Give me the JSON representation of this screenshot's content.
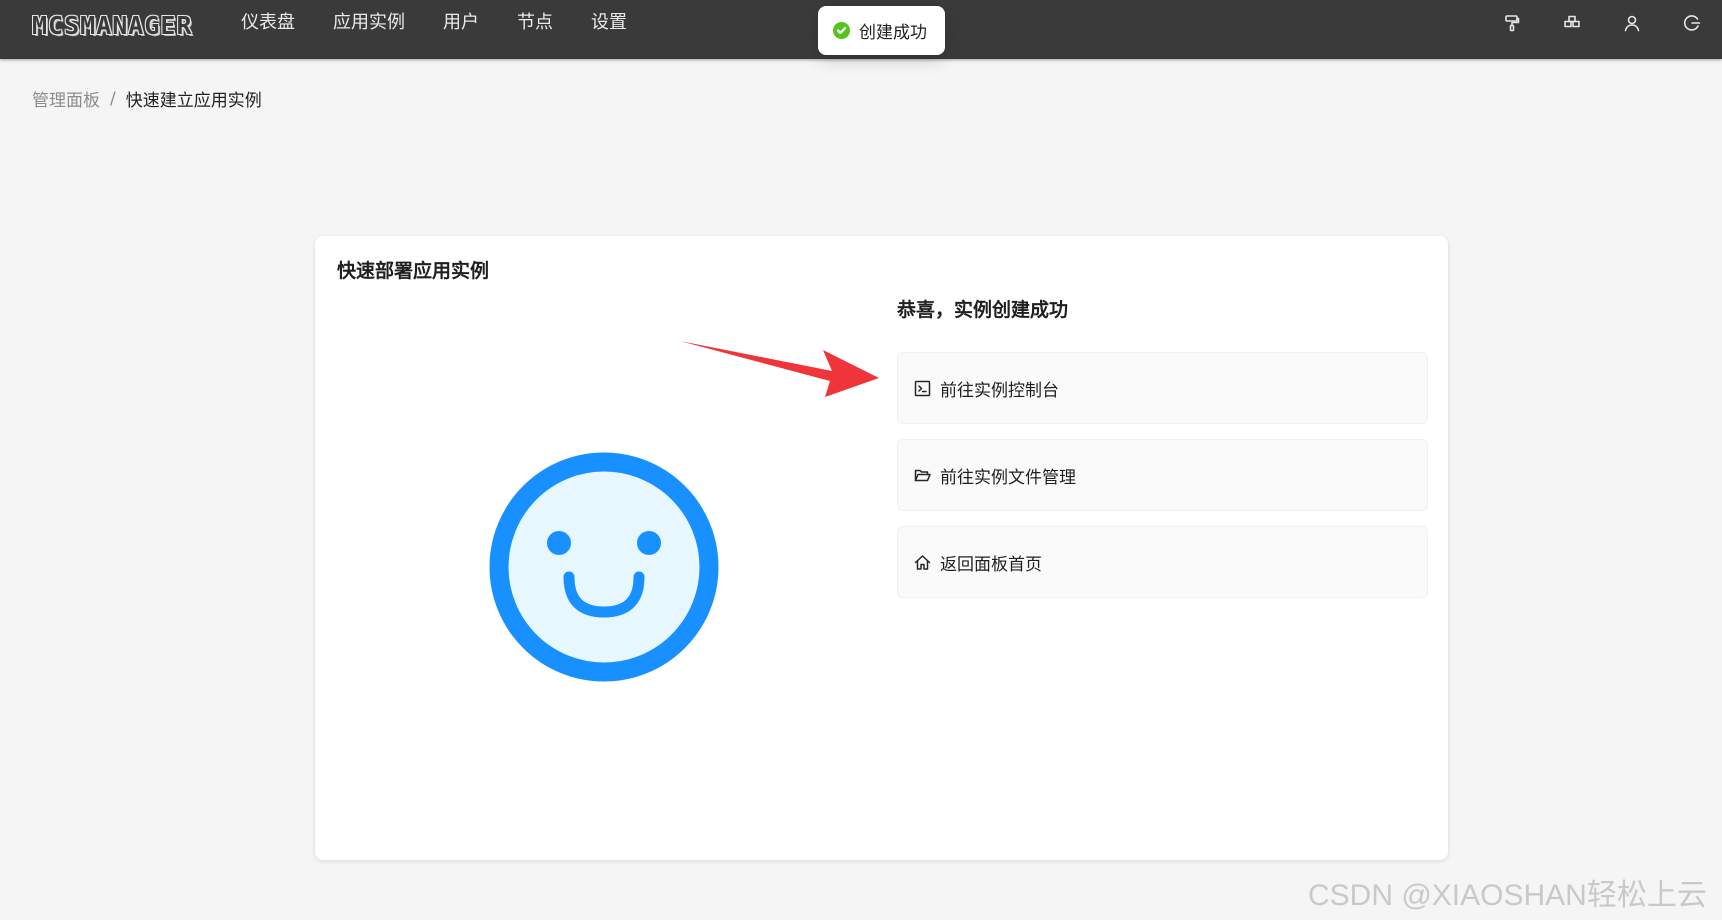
{
  "header": {
    "logo": "MCSMANAGER",
    "nav": [
      "仪表盘",
      "应用实例",
      "用户",
      "节点",
      "设置"
    ],
    "icons": [
      "paint-roller-icon",
      "layout-icon",
      "user-icon",
      "logout-icon"
    ]
  },
  "toast": {
    "message": "创建成功",
    "status_color": "#52c41a"
  },
  "breadcrumb": {
    "root": "管理面板",
    "separator": "/",
    "current": "快速建立应用实例"
  },
  "card": {
    "title": "快速部署应用实例",
    "success_title": "恭喜，实例创建成功",
    "actions": [
      {
        "label": "前往实例控制台",
        "icon": "terminal-icon"
      },
      {
        "label": "前往实例文件管理",
        "icon": "folder-open-icon"
      },
      {
        "label": "返回面板首页",
        "icon": "home-icon"
      }
    ]
  },
  "colors": {
    "accent": "#1890ff",
    "face_fill": "#e6f7ff",
    "arrow": "#f0353a",
    "topbar": "#3a3a3a"
  },
  "watermark": "CSDN @XIAOSHAN轻松上云"
}
